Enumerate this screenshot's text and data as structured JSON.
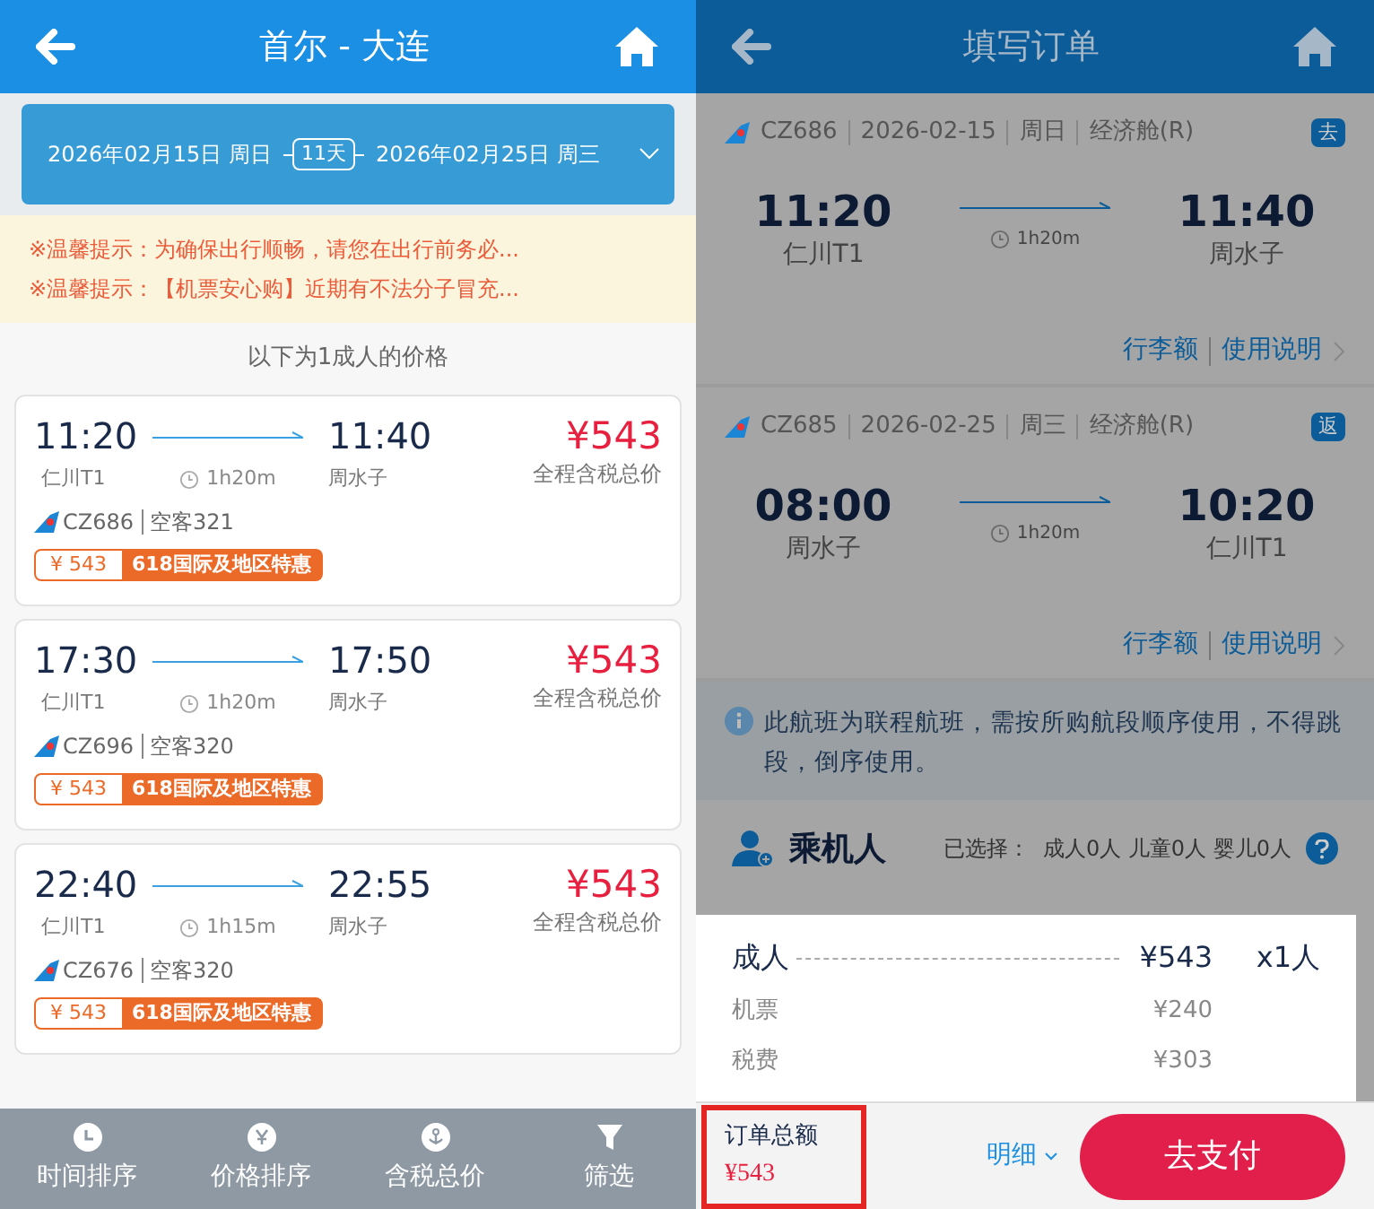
{
  "left": {
    "header": {
      "title": "首尔 - 大连"
    },
    "dates": {
      "depart": "2026年02月15日 周日",
      "days": "11天",
      "return": "2026年02月25日 周三"
    },
    "notices": [
      "※温馨提示：为确保出行顺畅，请您在出行前务必...",
      "※温馨提示：【机票安心购】近期有不法分子冒充..."
    ],
    "price_note": "以下为1成人的价格",
    "flights": [
      {
        "dep_time": "11:20",
        "arr_time": "11:40",
        "dep_airport": "仁川T1",
        "arr_airport": "周水子",
        "duration": "1h20m",
        "flight_no": "CZ686",
        "aircraft": "空客321",
        "price": "¥543",
        "price_label": "全程含税总价",
        "tag_price": "¥ 543",
        "tag_label": "618国际及地区特惠"
      },
      {
        "dep_time": "17:30",
        "arr_time": "17:50",
        "dep_airport": "仁川T1",
        "arr_airport": "周水子",
        "duration": "1h20m",
        "flight_no": "CZ696",
        "aircraft": "空客320",
        "price": "¥543",
        "price_label": "全程含税总价",
        "tag_price": "¥ 543",
        "tag_label": "618国际及地区特惠"
      },
      {
        "dep_time": "22:40",
        "arr_time": "22:55",
        "dep_airport": "仁川T1",
        "arr_airport": "周水子",
        "duration": "1h15m",
        "flight_no": "CZ676",
        "aircraft": "空客320",
        "price": "¥543",
        "price_label": "全程含税总价",
        "tag_price": "¥ 543",
        "tag_label": "618国际及地区特惠"
      }
    ],
    "bottom_bar": [
      {
        "label": "时间排序",
        "kind": "clock"
      },
      {
        "label": "价格排序",
        "kind": "yen"
      },
      {
        "label": "含税总价",
        "kind": "anchor"
      },
      {
        "label": "筛选",
        "kind": "filter"
      }
    ]
  },
  "right": {
    "header": {
      "title": "填写订单"
    },
    "segments": [
      {
        "flight_no": "CZ686",
        "date": "2026-02-15",
        "weekday": "周日",
        "cabin": "经济舱(R)",
        "badge": "去",
        "dep_time": "11:20",
        "arr_time": "11:40",
        "dep_airport": "仁川T1",
        "arr_airport": "周水子",
        "duration": "1h20m",
        "links": [
          "行李额",
          "使用说明"
        ]
      },
      {
        "flight_no": "CZ685",
        "date": "2026-02-25",
        "weekday": "周三",
        "cabin": "经济舱(R)",
        "badge": "返",
        "dep_time": "08:00",
        "arr_time": "10:20",
        "dep_airport": "周水子",
        "arr_airport": "仁川T1",
        "duration": "1h20m",
        "links": [
          "行李额",
          "使用说明"
        ]
      }
    ],
    "info": "此航班为联程航班，需按所购航段顺序使用，不得跳段，倒序使用。",
    "passengers": {
      "title": "乘机人",
      "selected": "已选择：  成人0人 儿童0人 婴儿0人"
    },
    "price_sheet": {
      "main": {
        "label": "成人",
        "price": "¥543",
        "count": "x1人"
      },
      "items": [
        {
          "label": "机票",
          "price": "¥240"
        },
        {
          "label": "税费",
          "price": "¥303"
        }
      ]
    },
    "footer": {
      "total_label": "订单总额",
      "total": "¥543",
      "detail": "明细",
      "pay": "去支付"
    }
  }
}
